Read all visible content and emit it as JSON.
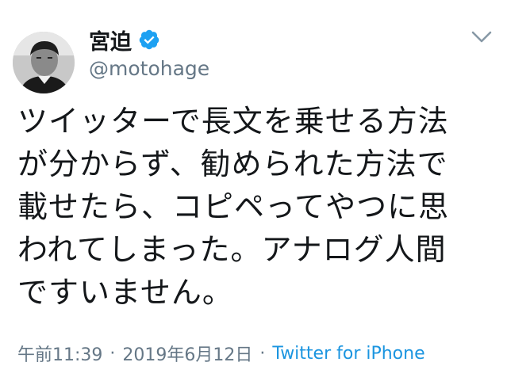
{
  "user": {
    "display_name": "宮迫",
    "handle": "@motohage",
    "verified": true
  },
  "tweet": {
    "text": "ツイッターで長文を乗せる方法\nが分からず、勧められた方法で\n載せたら、コピペってやつに思\nわれてしまった。アナログ人間\nですいません。"
  },
  "meta": {
    "time": "午前11:39",
    "separator": "·",
    "date": "2019年6月12日",
    "source": "Twitter for iPhone"
  },
  "colors": {
    "text": "#14171a",
    "secondary": "#657786",
    "link": "#1b95e0",
    "verified_badge": "#1da1f2"
  },
  "icons": {
    "verified": "verified-badge-icon",
    "menu": "chevron-down-icon"
  }
}
